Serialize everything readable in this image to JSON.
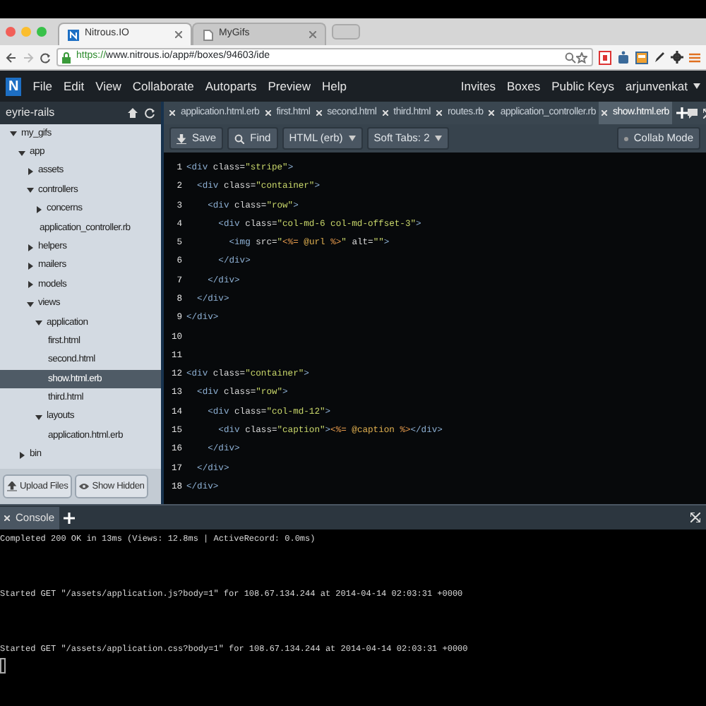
{
  "browser": {
    "tabs": [
      {
        "title": "Nitrous.IO",
        "selected": true
      },
      {
        "title": "MyGifs",
        "selected": false
      }
    ],
    "url_scheme": "https://",
    "url_path": "www.nitrous.io/app#/boxes/94603/ide"
  },
  "ide": {
    "logo": "N",
    "menu": [
      "File",
      "Edit",
      "View",
      "Collaborate",
      "Autoparts",
      "Preview",
      "Help"
    ],
    "account_links": [
      "Invites",
      "Boxes",
      "Public Keys"
    ],
    "user": "arjunvenkat"
  },
  "sidebar": {
    "project": "eyrie-rails",
    "tree": [
      {
        "label": "my_gifs",
        "kind": "folder",
        "expanded": true,
        "selected": false,
        "children": [
          {
            "label": "app",
            "kind": "folder",
            "expanded": true,
            "selected": false,
            "children": [
              {
                "label": "assets",
                "kind": "folder",
                "expanded": false,
                "selected": false
              },
              {
                "label": "controllers",
                "kind": "folder",
                "expanded": true,
                "selected": false,
                "children": [
                  {
                    "label": "concerns",
                    "kind": "folder",
                    "expanded": false,
                    "selected": false
                  },
                  {
                    "label": "application_controller.rb",
                    "kind": "file",
                    "selected": false
                  }
                ]
              },
              {
                "label": "helpers",
                "kind": "folder",
                "expanded": false,
                "selected": false
              },
              {
                "label": "mailers",
                "kind": "folder",
                "expanded": false,
                "selected": false
              },
              {
                "label": "models",
                "kind": "folder",
                "expanded": false,
                "selected": false
              },
              {
                "label": "views",
                "kind": "folder",
                "expanded": true,
                "selected": false,
                "children": [
                  {
                    "label": "application",
                    "kind": "folder",
                    "expanded": true,
                    "selected": false,
                    "children": [
                      {
                        "label": "first.html",
                        "kind": "file",
                        "selected": false
                      },
                      {
                        "label": "second.html",
                        "kind": "file",
                        "selected": false
                      },
                      {
                        "label": "show.html.erb",
                        "kind": "file",
                        "selected": true
                      },
                      {
                        "label": "third.html",
                        "kind": "file",
                        "selected": false
                      }
                    ]
                  },
                  {
                    "label": "layouts",
                    "kind": "folder",
                    "expanded": true,
                    "selected": false,
                    "children": [
                      {
                        "label": "application.html.erb",
                        "kind": "file",
                        "selected": false
                      }
                    ]
                  }
                ]
              }
            ]
          },
          {
            "label": "bin",
            "kind": "folder",
            "expanded": false,
            "selected": false
          }
        ]
      }
    ],
    "buttons": [
      "Upload Files",
      "Show Hidden"
    ]
  },
  "editor": {
    "tabs": [
      {
        "label": "application.html.erb",
        "selected": false
      },
      {
        "label": "first.html",
        "selected": false
      },
      {
        "label": "second.html",
        "selected": false
      },
      {
        "label": "third.html",
        "selected": false
      },
      {
        "label": "routes.rb",
        "selected": false
      },
      {
        "label": "application_controller.rb",
        "selected": false
      },
      {
        "label": "show.html.erb",
        "selected": true
      }
    ],
    "toolbar": {
      "save": "Save",
      "find": "Find",
      "mode": "HTML (erb)",
      "indent": "Soft Tabs: 2",
      "collab": "Collab Mode"
    },
    "lines": [
      {
        "number": "1",
        "segments": [
          {
            "kind": "tag",
            "text": "<div"
          },
          {
            "kind": "attr",
            "text": " class="
          },
          {
            "kind": "str",
            "text": "\"stripe\""
          },
          {
            "kind": "tag",
            "text": ">"
          }
        ]
      },
      {
        "number": "2",
        "segments": [
          {
            "kind": "tag",
            "text": "  <div"
          },
          {
            "kind": "attr",
            "text": " class="
          },
          {
            "kind": "str",
            "text": "\"container\""
          },
          {
            "kind": "tag",
            "text": ">"
          }
        ]
      },
      {
        "number": "3",
        "segments": [
          {
            "kind": "tag",
            "text": "    <div"
          },
          {
            "kind": "attr",
            "text": " class="
          },
          {
            "kind": "str",
            "text": "\"row\""
          },
          {
            "kind": "tag",
            "text": ">"
          }
        ]
      },
      {
        "number": "4",
        "segments": [
          {
            "kind": "tag",
            "text": "      <div"
          },
          {
            "kind": "attr",
            "text": " class="
          },
          {
            "kind": "str",
            "text": "\"col-md-6 col-md-offset-3\""
          },
          {
            "kind": "tag",
            "text": ">"
          }
        ]
      },
      {
        "number": "5",
        "segments": [
          {
            "kind": "tag",
            "text": "        <img"
          },
          {
            "kind": "attr",
            "text": " src="
          },
          {
            "kind": "str",
            "text": "\""
          },
          {
            "kind": "erb",
            "text": "<%="
          },
          {
            "kind": "var",
            "text": " @url "
          },
          {
            "kind": "erb",
            "text": "%>"
          },
          {
            "kind": "str",
            "text": "\""
          },
          {
            "kind": "attr",
            "text": " alt="
          },
          {
            "kind": "str",
            "text": "\"\""
          },
          {
            "kind": "tag",
            "text": ">"
          }
        ]
      },
      {
        "number": "6",
        "segments": [
          {
            "kind": "tag",
            "text": "      </div>"
          }
        ]
      },
      {
        "number": "7",
        "segments": [
          {
            "kind": "tag",
            "text": "    </div>"
          }
        ]
      },
      {
        "number": "8",
        "segments": [
          {
            "kind": "tag",
            "text": "  </div>"
          }
        ]
      },
      {
        "number": "9",
        "segments": [
          {
            "kind": "tag",
            "text": "</div>"
          }
        ]
      },
      {
        "number": "10"
      },
      {
        "number": "11"
      },
      {
        "number": "12",
        "segments": [
          {
            "kind": "tag",
            "text": "<div"
          },
          {
            "kind": "attr",
            "text": " class="
          },
          {
            "kind": "str",
            "text": "\"container\""
          },
          {
            "kind": "tag",
            "text": ">"
          }
        ]
      },
      {
        "number": "13",
        "segments": [
          {
            "kind": "tag",
            "text": "  <div"
          },
          {
            "kind": "attr",
            "text": " class="
          },
          {
            "kind": "str",
            "text": "\"row\""
          },
          {
            "kind": "tag",
            "text": ">"
          }
        ]
      },
      {
        "number": "14",
        "segments": [
          {
            "kind": "tag",
            "text": "    <div"
          },
          {
            "kind": "attr",
            "text": " class="
          },
          {
            "kind": "str",
            "text": "\"col-md-12\""
          },
          {
            "kind": "tag",
            "text": ">"
          }
        ]
      },
      {
        "number": "15",
        "segments": [
          {
            "kind": "tag",
            "text": "      <div"
          },
          {
            "kind": "attr",
            "text": " class="
          },
          {
            "kind": "str",
            "text": "\"caption\""
          },
          {
            "kind": "tag",
            "text": ">"
          },
          {
            "kind": "erb",
            "text": "<%="
          },
          {
            "kind": "var",
            "text": " @caption "
          },
          {
            "kind": "erb",
            "text": "%>"
          },
          {
            "kind": "tag",
            "text": "</div>"
          }
        ]
      },
      {
        "number": "16",
        "segments": [
          {
            "kind": "tag",
            "text": "    </div>"
          }
        ]
      },
      {
        "number": "17",
        "segments": [
          {
            "kind": "tag",
            "text": "  </div>"
          }
        ]
      },
      {
        "number": "18",
        "segments": [
          {
            "kind": "tag",
            "text": "</div>"
          }
        ]
      }
    ]
  },
  "console": {
    "tab": "Console",
    "lines": [
      "Completed 200 OK in 13ms (Views: 12.8ms | ActiveRecord: 0.0ms)",
      "Started GET \"/assets/application.js?body=1\" for 108.67.134.244 at 2014-04-14 02:03:31 +0000",
      "Started GET \"/assets/application.css?body=1\" for 108.67.134.244 at 2014-04-14 02:03:31 +0000"
    ]
  }
}
